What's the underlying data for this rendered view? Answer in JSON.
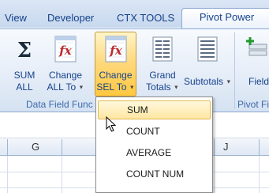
{
  "tabs": [
    "View",
    "Developer",
    "CTX TOOLS",
    "Pivot Power"
  ],
  "active_tab": "Pivot Power",
  "ribbon": {
    "sum_all": {
      "line1": "SUM",
      "line2": "ALL",
      "icon": "sigma-icon"
    },
    "change_all": {
      "line1": "Change",
      "line2": "ALL To",
      "icon": "function-fx-icon"
    },
    "change_sel": {
      "line1": "Change",
      "line2": "SEL To",
      "icon": "function-fx-icon"
    },
    "grand_totals": {
      "line1": "Grand",
      "line2": "Totals",
      "icon": "grand-totals-icon"
    },
    "subtotals": {
      "line1": "Subtotals",
      "icon": "subtotals-icon"
    },
    "fields": {
      "line1": "Field",
      "icon": "add-field-icon"
    },
    "group_data_field": "Data Field Func",
    "group_pivot_field": "Pivot Fi"
  },
  "columns": [
    "G",
    "J"
  ],
  "menu": {
    "items": [
      "SUM",
      "COUNT",
      "AVERAGE",
      "COUNT NUM"
    ],
    "highlighted": "SUM"
  },
  "colors": {
    "ribbon_text": "#15428b",
    "highlight": "#ffd980",
    "menu_highlight": "#ffe7a3"
  }
}
